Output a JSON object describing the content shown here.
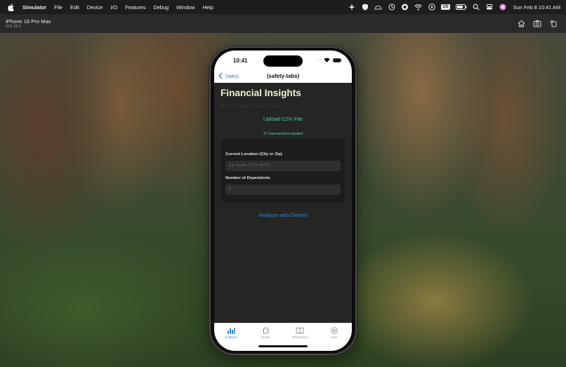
{
  "menubar": {
    "items": [
      "Simulator",
      "File",
      "Edit",
      "Device",
      "I/O",
      "Features",
      "Debug",
      "Window",
      "Help"
    ],
    "input_source": "US",
    "datetime": "Sun Feb 8  10:41 AM"
  },
  "simulator": {
    "device_name": "iPhone 16 Pro Max",
    "os_version": "iOS 18.3"
  },
  "status_bar": {
    "time": "10:41"
  },
  "nav": {
    "back_label": "(tabs)",
    "title": "(safety-tabs)"
  },
  "page": {
    "title": "Financial Insights",
    "step_hint": "Step 1: Upload Transaction Data",
    "upload_label": "Upload CSV File",
    "transactions_loaded": "47 transactions loaded",
    "location_label": "Current Location (City or Zip)",
    "location_placeholder": "e.g. Austin, TX or 78701",
    "dependents_label": "Number of Dependents",
    "dependents_value": "0",
    "analyze_label": "Analyze with Gemini"
  },
  "tabs": [
    {
      "label": "Analyzer",
      "icon": "bar-chart-icon",
      "active": true
    },
    {
      "label": "Home",
      "icon": "house-icon",
      "active": false
    },
    {
      "label": "Resources",
      "icon": "book-icon",
      "active": false
    },
    {
      "label": "Exit",
      "icon": "close-circle-icon",
      "active": false
    }
  ],
  "colors": {
    "accent_green": "#5ec3a8",
    "accent_blue": "#3b82d6",
    "title_cream": "#f0edd6",
    "background": "#252624"
  }
}
